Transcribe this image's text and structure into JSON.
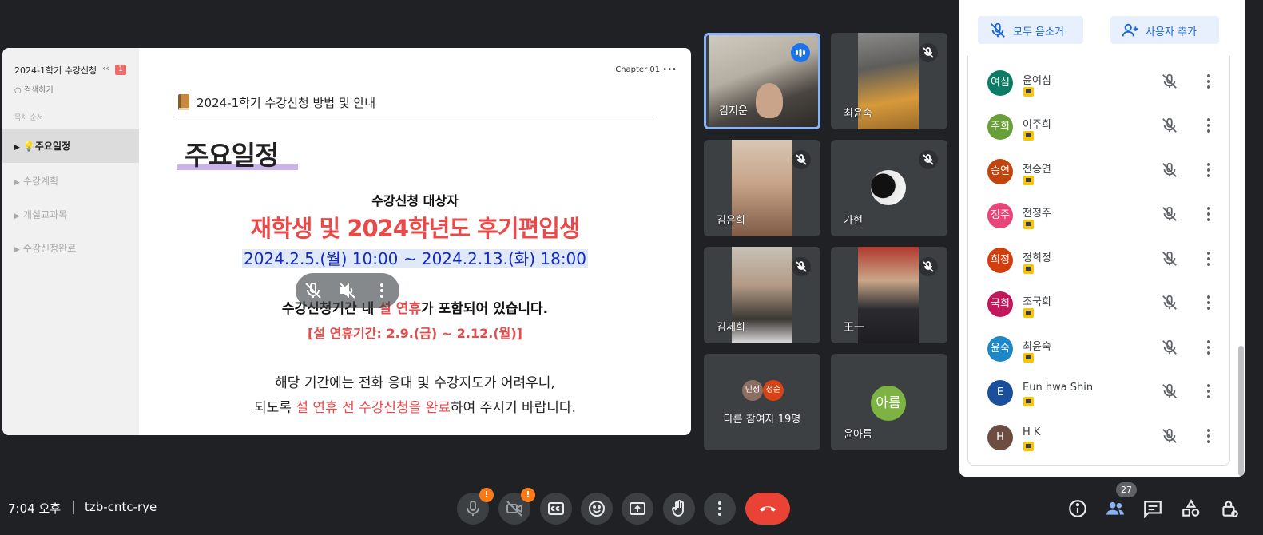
{
  "slide": {
    "toc": {
      "title": "2024-1학기 수강신청",
      "badge": "1",
      "search": "검색하기",
      "section_label": "목차 순서",
      "items": [
        {
          "label": "주요일정",
          "icon": "💡"
        },
        {
          "label": "수강계획"
        },
        {
          "label": "개설교과목"
        },
        {
          "label": "수강신청완료"
        }
      ]
    },
    "chapter": "Chapter 01",
    "doc_title": "2024-1학기 수강신청 방법 및 안내",
    "section_title": "주요일정",
    "target_label": "수강신청 대상자",
    "target_value": "재학생 및 2024학년도 후기편입생",
    "period": "2024.2.5.(월) 10:00 ~ 2024.2.13.(화) 18:00",
    "notice_pre": "수강신청기간 내 ",
    "notice_red": "설 연휴",
    "notice_post": "가 포함되어 있습니다.",
    "holiday": "[설 연휴기간: 2.9.(금) ~ 2.12.(월)]",
    "info_line1": "해당 기간에는 전화 응대 및 수강지도가 어려우니,",
    "info_line2_pre": "되도록 ",
    "info_line2_red": "설 연휴 전 수강신청을 완료",
    "info_line2_post": "하여 주시기 바랍니다."
  },
  "tiles": [
    {
      "name": "김지운",
      "state": "speaking"
    },
    {
      "name": "최윤숙",
      "state": "muted"
    },
    {
      "name": "김은희",
      "state": "muted"
    },
    {
      "name": "가현",
      "state": "muted"
    },
    {
      "name": "김세희",
      "state": "muted"
    },
    {
      "name": "王一",
      "state": "muted"
    },
    {
      "name": "다른 참여자 19명",
      "avatars": [
        "민정",
        "정순"
      ]
    },
    {
      "name": "윤아름",
      "avatar": "아름"
    }
  ],
  "panel": {
    "mute_all": "모두 음소거",
    "add_people": "사용자 추가",
    "participants": [
      {
        "initials": "여심",
        "name": "윤여심",
        "color": "#0d7c66"
      },
      {
        "initials": "주희",
        "name": "이주희",
        "color": "#689f38"
      },
      {
        "initials": "승연",
        "name": "전승연",
        "color": "#c1440e"
      },
      {
        "initials": "정주",
        "name": "전정주",
        "color": "#e8457a"
      },
      {
        "initials": "희정",
        "name": "정희정",
        "color": "#d23f0f"
      },
      {
        "initials": "국희",
        "name": "조국희",
        "color": "#c2185b"
      },
      {
        "initials": "윤숙",
        "name": "최윤숙",
        "color": "#1e88c7"
      },
      {
        "initials": "E",
        "name": "Eun hwa Shin",
        "color": "#1a4f9c"
      },
      {
        "initials": "H",
        "name": "H K",
        "color": "#6d4c41"
      }
    ]
  },
  "bottom": {
    "time": "7:04 오후",
    "meeting_code": "tzb-cntc-rye",
    "participant_count": "27",
    "alert": "!"
  },
  "colors": {
    "end_call": "#ea4335",
    "accent": "#8ab4f8",
    "alert": "#fa7b17"
  }
}
